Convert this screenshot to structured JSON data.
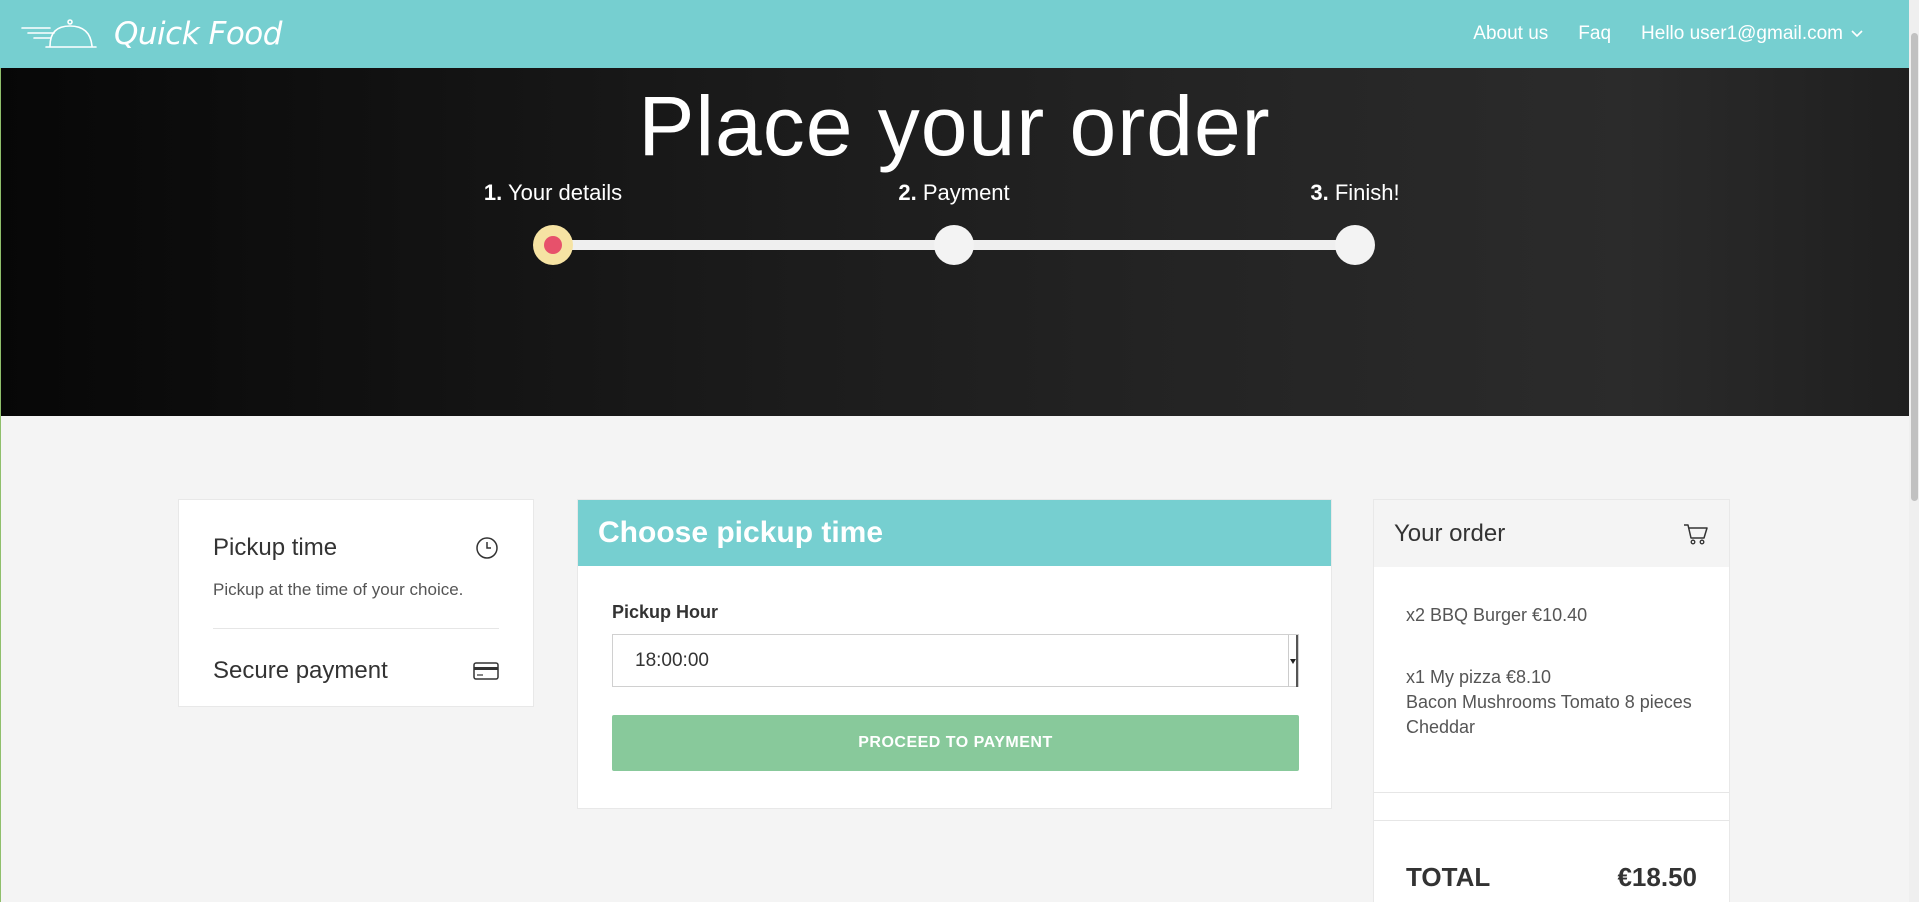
{
  "navbar": {
    "brand": "Quick Food",
    "links": {
      "about": "About us",
      "faq": "Faq"
    },
    "user_greeting": "Hello user1@gmail.com"
  },
  "hero": {
    "title": "Place your order",
    "steps": [
      {
        "num": "1.",
        "label": "Your details"
      },
      {
        "num": "2.",
        "label": "Payment"
      },
      {
        "num": "3.",
        "label": "Finish!"
      }
    ],
    "active_step": 1
  },
  "info": {
    "pickup_title": "Pickup time",
    "pickup_text": "Pickup at the time of your choice.",
    "payment_title": "Secure payment"
  },
  "form": {
    "header": "Choose pickup time",
    "field_label": "Pickup Hour",
    "selected_value": "18:00:00",
    "proceed_label": "PROCEED TO PAYMENT"
  },
  "order": {
    "title": "Your order",
    "items": [
      {
        "line": "x2 BBQ Burger €10.40",
        "extras": ""
      },
      {
        "line": "x1 My pizza €8.10",
        "extras": "Bacon Mushrooms Tomato 8 pieces Cheddar"
      }
    ],
    "total_label": "TOTAL",
    "total_value": "€18.50"
  },
  "colors": {
    "accent": "#76cfd0",
    "proceed": "#88c99b",
    "active_step": "#e7516b"
  }
}
